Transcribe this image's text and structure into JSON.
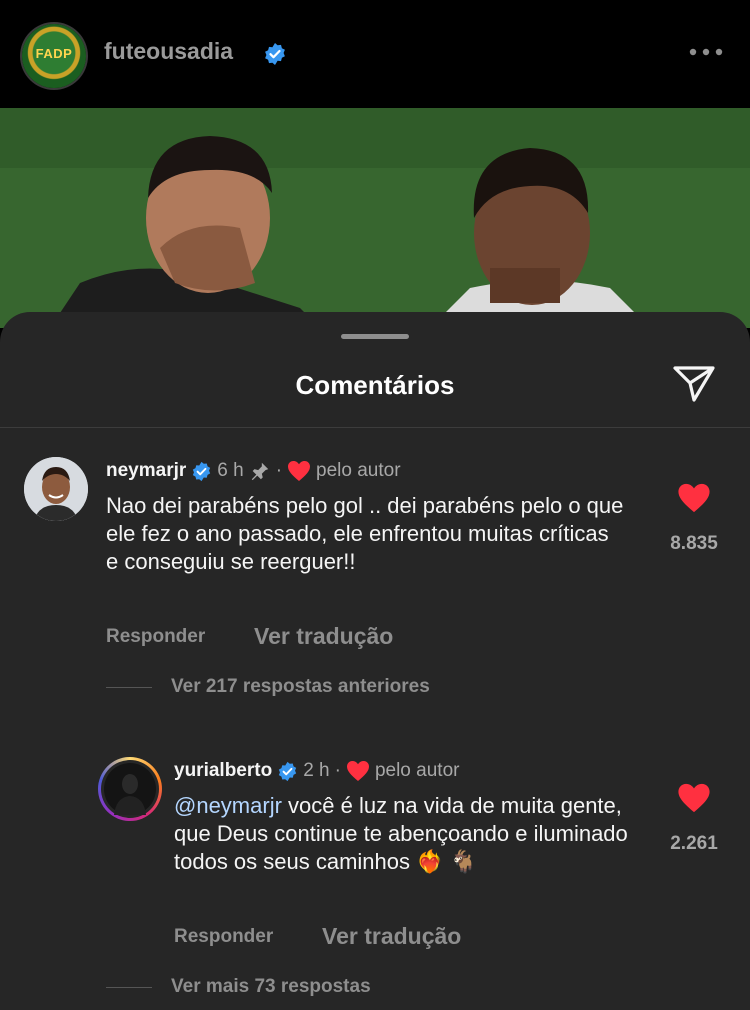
{
  "post": {
    "account": "futeousadia",
    "logo_text": "FADP"
  },
  "sheet": {
    "title": "Comentários"
  },
  "comments": [
    {
      "username": "neymarjr",
      "time": "6 h",
      "separator": "·",
      "liked_by_author": "pelo autor",
      "text": "Nao dei parabéns pelo gol .. dei parabéns pelo o que ele fez o ano passado, ele enfrentou muitas críticas e conseguiu se reerguer!!",
      "likes": "8.835",
      "reply_label": "Responder",
      "translate_label": "Ver tradução",
      "thread_label": "Ver 217 respostas anteriores"
    },
    {
      "username": "yurialberto",
      "time": "2 h",
      "separator": "·",
      "liked_by_author": "pelo autor",
      "mention": "@neymarjr",
      "text": " você é luz na vida de muita gente, que Deus continue te abençoando e iluminado todos os seus caminhos ",
      "emojis": "❤️‍🔥 🐐",
      "likes": "2.261",
      "reply_label": "Responder",
      "translate_label": "Ver tradução",
      "thread_label": "Ver mais 73 respostas"
    }
  ],
  "colors": {
    "verified": "#3897f0",
    "heart": "#ff3040",
    "mention": "#b4d6ff"
  }
}
